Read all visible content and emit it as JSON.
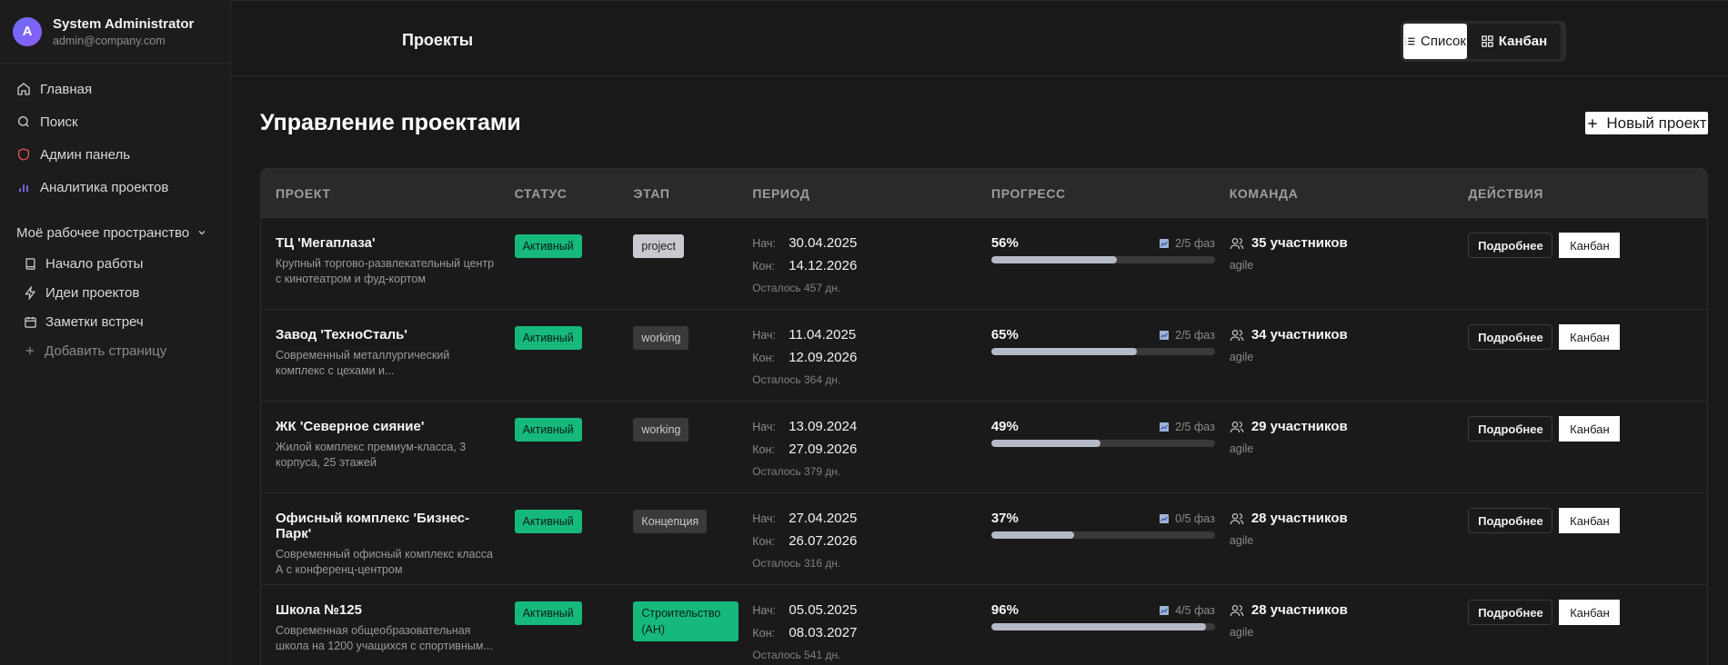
{
  "user": {
    "initial": "A",
    "name": "System Administrator",
    "email": "admin@company.com"
  },
  "nav": [
    {
      "label": "Главная",
      "icon": "home-icon"
    },
    {
      "label": "Поиск",
      "icon": "search-icon"
    },
    {
      "label": "Админ панель",
      "icon": "shield-icon"
    },
    {
      "label": "Аналитика проектов",
      "icon": "bar-chart-icon"
    }
  ],
  "workspace": {
    "title": "Моё рабочее пространство",
    "items": [
      {
        "label": "Начало работы",
        "icon": "book-icon"
      },
      {
        "label": "Идеи проектов",
        "icon": "lightning-icon"
      },
      {
        "label": "Заметки встреч",
        "icon": "calendar-icon"
      }
    ],
    "add_label": "Добавить страницу"
  },
  "topbar": {
    "title": "Проекты",
    "list_label": "Список",
    "kanban_label": "Канбан",
    "active_view": "kanban"
  },
  "main": {
    "title": "Управление проектами",
    "new_button": "Новый проект"
  },
  "table": {
    "headers": [
      "ПРОЕКТ",
      "СТАТУС",
      "ЭТАП",
      "ПЕРИОД",
      "ПРОГРЕСС",
      "КОМАНДА",
      "ДЕЙСТВИЯ"
    ],
    "start_label": "Нач:",
    "end_label": "Кон:",
    "more_label": "Подробнее",
    "kanban_label": "Канбан",
    "rows": [
      {
        "name": "ТЦ 'Мегаплаза'",
        "desc": "Крупный торгово-развлекательный центр с кинотеатром и фуд-кортом",
        "status": "Активный",
        "stage": "project",
        "stage_style": "project",
        "start": "30.04.2025",
        "end": "14.12.2026",
        "remaining": "Осталось 457 дн.",
        "progress": "56%",
        "progress_value": 56,
        "phases": "2/5 фаз",
        "team": "35 участников",
        "method": "agile"
      },
      {
        "name": "Завод 'ТехноСталь'",
        "desc": "Современный металлургический комплекс с цехами и...",
        "status": "Активный",
        "stage": "working",
        "stage_style": "gray",
        "start": "11.04.2025",
        "end": "12.09.2026",
        "remaining": "Осталось 364 дн.",
        "progress": "65%",
        "progress_value": 65,
        "phases": "2/5 фаз",
        "team": "34 участников",
        "method": "agile"
      },
      {
        "name": "ЖК 'Северное сияние'",
        "desc": "Жилой комплекс премиум-класса, 3 корпуса, 25 этажей",
        "status": "Активный",
        "stage": "working",
        "stage_style": "gray",
        "start": "13.09.2024",
        "end": "27.09.2026",
        "remaining": "Осталось 379 дн.",
        "progress": "49%",
        "progress_value": 49,
        "phases": "2/5 фаз",
        "team": "29 участников",
        "method": "agile"
      },
      {
        "name": "Офисный комплекс 'Бизнес-Парк'",
        "desc": "Современный офисный комплекс класса А с конференц-центром",
        "status": "Активный",
        "stage": "Концепция",
        "stage_style": "gray",
        "start": "27.04.2025",
        "end": "26.07.2026",
        "remaining": "Осталось 316 дн.",
        "progress": "37%",
        "progress_value": 37,
        "phases": "0/5 фаз",
        "team": "28 участников",
        "method": "agile"
      },
      {
        "name": "Школа №125",
        "desc": "Современная общеобразовательная школа на 1200 учащихся с спортивным...",
        "status": "Активный",
        "stage": "Строительство (АН)",
        "stage_style": "green",
        "start": "05.05.2025",
        "end": "08.03.2027",
        "remaining": "Осталось 541 дн.",
        "progress": "96%",
        "progress_value": 96,
        "phases": "4/5 фаз",
        "team": "28 участников",
        "method": "agile"
      }
    ]
  },
  "colors": {
    "accent_green": "#16b97b",
    "progress_fill": "#b6bac7",
    "background": "#191919",
    "avatar": "#7c6cf6"
  }
}
